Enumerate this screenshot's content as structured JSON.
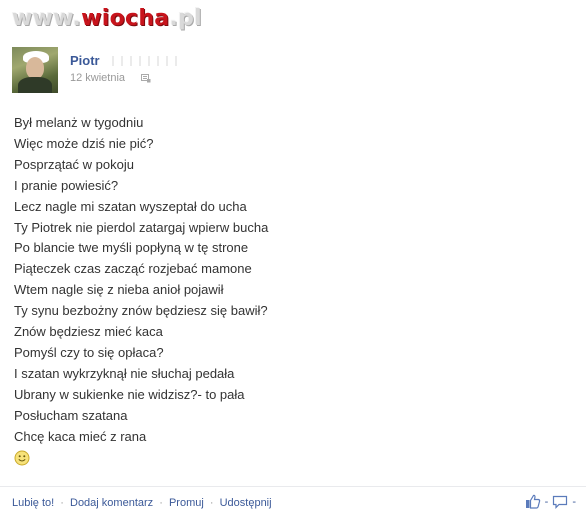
{
  "watermark": {
    "part1": "www.",
    "part2": "wiocha",
    "part3": ".pl"
  },
  "post": {
    "author": "Piotr",
    "timestamp": "12 kwietnia",
    "lines": [
      "Był melanż w tygodniu",
      "Więc może dziś nie pić?",
      "Posprzątać w pokoju",
      "I pranie powiesić?",
      "Lecz nagle mi szatan wyszeptał do ucha",
      "Ty Piotrek nie pierdol zatargaj wpierw bucha",
      "Po blancie twe myśli popłyną w tę strone",
      "Piąteczek czas zacząć rozjebać mamone",
      "Wtem nagle się z nieba anioł pojawił",
      "Ty synu bezbożny znów będziesz się bawił?",
      "Znów będziesz mieć kaca",
      "Pomyśl czy to się opłaca?",
      "I szatan wykrzyknął nie słuchaj pedała",
      "Ubrany w sukienke nie widzisz?- to pała",
      "Posłucham szatana",
      "Chcę kaca mieć z rana"
    ]
  },
  "actions": {
    "like": "Lubię to!",
    "comment": "Dodaj komentarz",
    "promote": "Promuj",
    "share": "Udostępnij",
    "separator": "·"
  },
  "counts": {
    "likes_marker": "-",
    "comments_marker": "-"
  },
  "colors": {
    "link": "#3b5998",
    "meta": "#999999",
    "text": "#333333",
    "watermark_red": "#c8141c"
  }
}
